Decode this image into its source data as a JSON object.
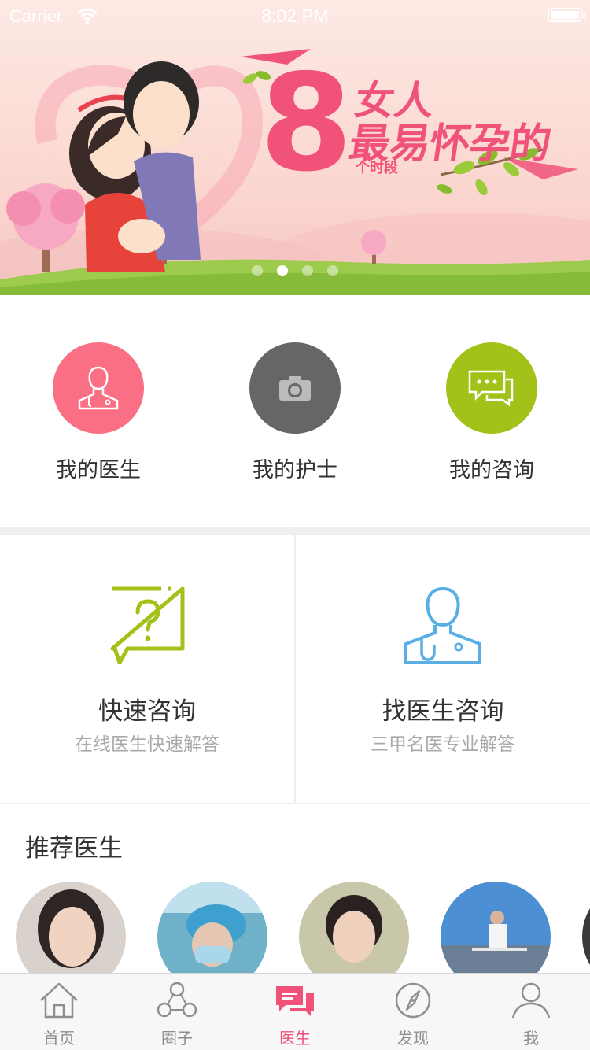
{
  "status_bar": {
    "carrier": "Carrier",
    "time": "8:02 PM"
  },
  "banner": {
    "number": "8",
    "line1": "女人",
    "line2": "最易怀孕的",
    "line3": "个时段",
    "page_count": 4,
    "active_page": 2,
    "accent_color": "#f0527a"
  },
  "quick_actions": [
    {
      "label": "我的医生",
      "icon": "doctor-icon",
      "color": "#fb6f84"
    },
    {
      "label": "我的护士",
      "icon": "camera-icon",
      "color": "#666666"
    },
    {
      "label": "我的咨询",
      "icon": "chat-bubbles-icon",
      "color": "#a3c219"
    }
  ],
  "consult": {
    "quick": {
      "title": "快速咨询",
      "subtitle": "在线医生快速解答",
      "icon": "question-bubble-icon",
      "color": "#a3c219"
    },
    "doctor": {
      "title": "找医生咨询",
      "subtitle": "三甲名医专业解答",
      "icon": "doctor-outline-icon",
      "color": "#5aaee6"
    }
  },
  "recommended": {
    "title": "推荐医生",
    "count_visible": 4
  },
  "tabbar": {
    "items": [
      {
        "label": "首页",
        "icon": "home-icon"
      },
      {
        "label": "圈子",
        "icon": "circle-group-icon"
      },
      {
        "label": "医生",
        "icon": "doctor-chat-icon"
      },
      {
        "label": "发现",
        "icon": "compass-icon"
      },
      {
        "label": "我",
        "icon": "profile-icon"
      }
    ],
    "active_index": 2,
    "active_color": "#f0527a",
    "inactive_color": "#8e8e8e"
  }
}
